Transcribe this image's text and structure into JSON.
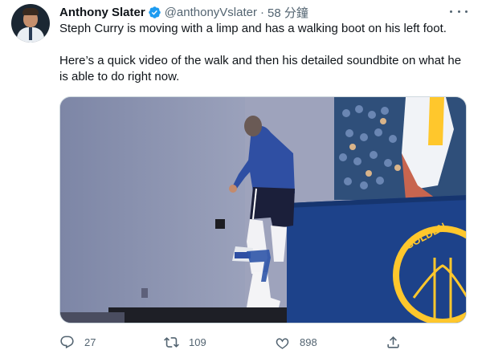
{
  "tweet": {
    "author_name": "Anthony Slater",
    "handle": "@anthonyVslater",
    "separator": "·",
    "timestamp": "58 分鐘",
    "text_line1": "Steph Curry is moving with a limp and has a walking boot on his left foot.",
    "text_line2": "Here’s a quick video of the walk and then his detailed soundbite on what he is able to do right now.",
    "media_logo_text": "GOLDEN"
  },
  "actions": {
    "reply_count": "27",
    "retweet_count": "109",
    "like_count": "898"
  },
  "icons": {
    "verified": "verified-badge-icon",
    "more": "more-horizontal-icon",
    "reply": "reply-icon",
    "retweet": "retweet-icon",
    "like": "heart-icon",
    "share": "share-icon"
  },
  "colors": {
    "verified_blue": "#1d9bf0",
    "text_secondary": "#536471",
    "warriors_blue": "#1d428a",
    "warriors_gold": "#ffc72c"
  }
}
